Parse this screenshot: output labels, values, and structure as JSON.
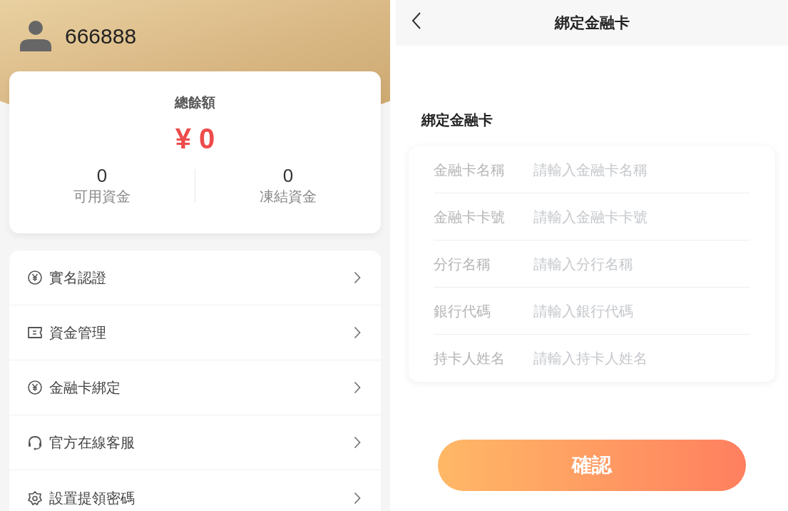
{
  "profile": {
    "username": "666888"
  },
  "balance": {
    "title": "總餘額",
    "amount": "¥ 0",
    "stats": [
      {
        "value": "0",
        "label": "可用資金"
      },
      {
        "value": "0",
        "label": "凍結資金"
      }
    ]
  },
  "menu": [
    {
      "kind": "yen",
      "label": "實名認證"
    },
    {
      "kind": "ticket",
      "label": "資金管理"
    },
    {
      "kind": "yen",
      "label": "金融卡綁定"
    },
    {
      "kind": "headset",
      "label": "官方在線客服"
    },
    {
      "kind": "gear",
      "label": "設置提領密碼"
    }
  ],
  "bind_page": {
    "title": "綁定金融卡",
    "section_title": "綁定金融卡",
    "fields": [
      {
        "label": "金融卡名稱",
        "placeholder": "請輸入金融卡名稱"
      },
      {
        "label": "金融卡卡號",
        "placeholder": "請輸入金融卡卡號"
      },
      {
        "label": "分行名稱",
        "placeholder": "請輸入分行名稱"
      },
      {
        "label": "銀行代碼",
        "placeholder": "請輸入銀行代碼"
      },
      {
        "label": "持卡人姓名",
        "placeholder": "請輸入持卡人姓名"
      }
    ],
    "confirm": "確認"
  }
}
